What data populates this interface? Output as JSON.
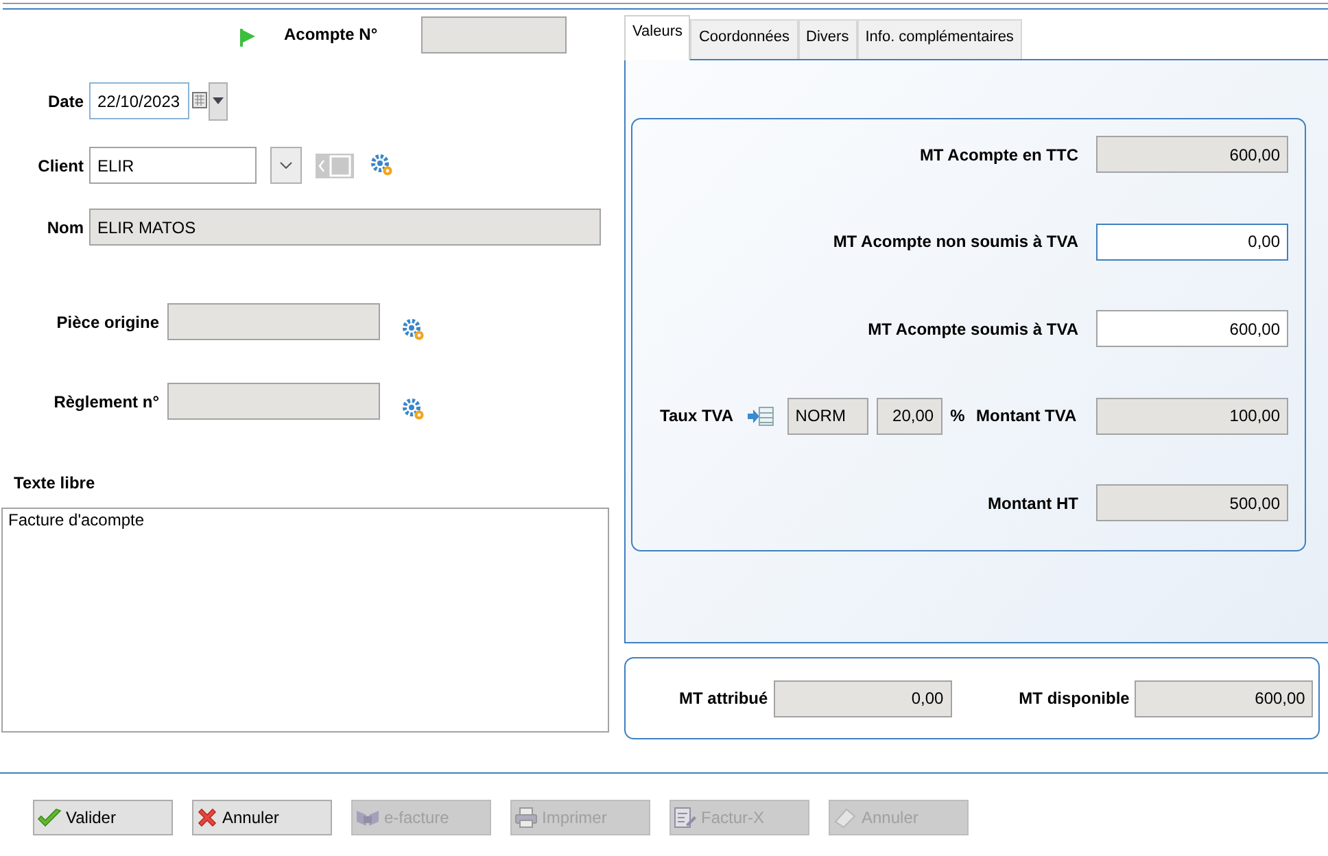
{
  "acompte": {
    "label": "Acompte N°"
  },
  "date": {
    "label": "Date",
    "value": "22/10/2023"
  },
  "client": {
    "label": "Client",
    "value": "ELIR"
  },
  "nom": {
    "label": "Nom",
    "value": "ELIR MATOS"
  },
  "piece_origine": {
    "label": "Pièce origine"
  },
  "reglement": {
    "label": "Règlement n°"
  },
  "texte_libre": {
    "label": "Texte libre",
    "value": "Facture d'acompte"
  },
  "tabs": [
    {
      "label": "Valeurs",
      "selected": true
    },
    {
      "label": "Coordonnées",
      "selected": false
    },
    {
      "label": "Divers",
      "selected": false
    },
    {
      "label": "Info. complémentaires",
      "selected": false
    }
  ],
  "amounts": [
    {
      "kind": "amount",
      "label": "MT Acompte en TTC",
      "value": "600,00",
      "read_only": true,
      "focused": false
    },
    {
      "kind": "amount",
      "label": "MT Acompte non soumis à TVA",
      "value": "0,00",
      "read_only": false,
      "focused": true
    },
    {
      "kind": "amount",
      "label": "MT Acompte soumis à TVA",
      "value": "600,00",
      "read_only": false,
      "focused": false
    },
    {
      "kind": "tva",
      "label": "Taux TVA",
      "code": "NORM",
      "rate": "20,00",
      "unit": "%",
      "amount_label": "Montant TVA",
      "value": "100,00",
      "read_only": true,
      "focused": false
    },
    {
      "kind": "amount",
      "label": "Montant HT",
      "value": "500,00",
      "read_only": true,
      "focused": false
    }
  ],
  "totals": [
    {
      "label": "MT attribué",
      "value": "0,00"
    },
    {
      "label": "MT disponible",
      "value": "600,00"
    }
  ],
  "buttons": [
    {
      "kind": "check",
      "label": "Valider",
      "disabled": false
    },
    {
      "kind": "cross",
      "label": "Annuler",
      "disabled": false
    },
    {
      "kind": "efacture",
      "label": "e-facture",
      "disabled": true
    },
    {
      "kind": "printer",
      "label": "Imprimer",
      "disabled": true
    },
    {
      "kind": "facturx",
      "label": "Factur-X",
      "disabled": true
    },
    {
      "kind": "eraser",
      "label": "Annuler",
      "disabled": true
    }
  ]
}
